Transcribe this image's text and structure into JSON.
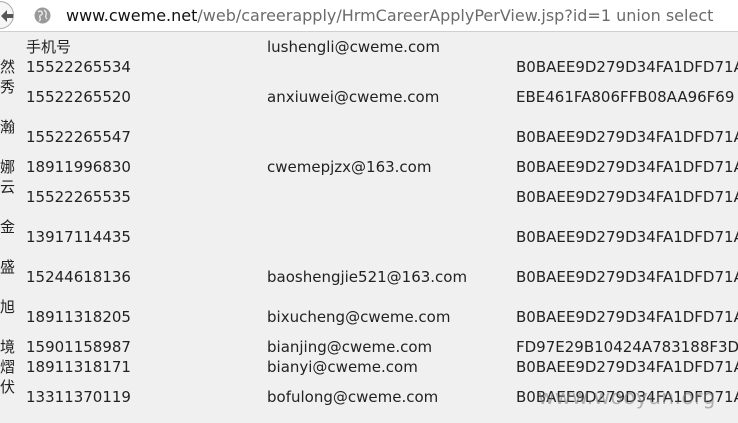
{
  "browser": {
    "url_host": "www.cweme.net",
    "url_path": "/web/careerapply/HrmCareerApplyPerView.jsp?id=1 union select"
  },
  "side_chars": [
    "然",
    "秀",
    "瀚",
    "娜",
    "云",
    "金",
    "盛",
    "旭",
    "境",
    "熠",
    "伏"
  ],
  "header": {
    "phone_label": "手机号",
    "header_email": "lushengli@cweme.com"
  },
  "rows": [
    {
      "phone": "15522265534",
      "email": "",
      "hash": "B0BAEE9D279D34FA1DFD71A"
    },
    {
      "phone": "15522265520",
      "email": "anxiuwei@cweme.com",
      "hash": "EBE461FA806FFB08AA96F69"
    },
    {
      "phone": "15522265547",
      "email": "",
      "hash": "B0BAEE9D279D34FA1DFD71A"
    },
    {
      "phone": "18911996830",
      "email": "cwemepjzx@163.com",
      "hash": "B0BAEE9D279D34FA1DFD71A"
    },
    {
      "phone": "15522265535",
      "email": "",
      "hash": "B0BAEE9D279D34FA1DFD71A"
    },
    {
      "phone": "13917114435",
      "email": "",
      "hash": "B0BAEE9D279D34FA1DFD71A"
    },
    {
      "phone": "15244618136",
      "email": "baoshengjie521@163.com",
      "hash": "B0BAEE9D279D34FA1DFD71A"
    },
    {
      "phone": "18911318205",
      "email": "bixucheng@cweme.com",
      "hash": "B0BAEE9D279D34FA1DFD71A"
    },
    {
      "phone": "15901158987",
      "email": "bianjing@cweme.com",
      "hash": "FD97E29B10424A783188F3D"
    },
    {
      "phone": "18911318171",
      "email": "bianyi@cweme.com",
      "hash": "B0BAEE9D279D34FA1DFD71A"
    },
    {
      "phone": "13311370119",
      "email": "bofulong@cweme.com",
      "hash": "B0BAEE9D279D34FA1DFD71A"
    }
  ],
  "watermark": "www.wooyun.org",
  "icons": {
    "back": "back-arrow-icon",
    "site": "globe-icon"
  },
  "colors": {
    "page_bg": "#f0f0f0",
    "urlbar_bg": "#ffffff",
    "text": "#222222",
    "url_path": "#6b6b6b"
  }
}
